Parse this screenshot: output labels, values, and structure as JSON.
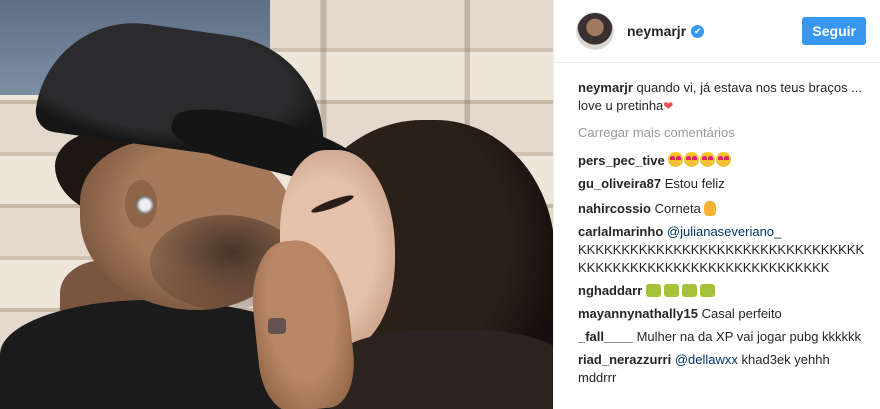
{
  "post": {
    "username": "neymarjr",
    "follow_label": "Seguir",
    "verified_glyph": "✔",
    "caption_text": "quando vi, já estava nos teus braços ... love u pretinha",
    "caption_heart": "❤",
    "load_more": "Carregar mais comentários"
  },
  "comments": [
    {
      "user": "pers_pec_tive",
      "text": "",
      "emoji": "heart-eyes-emoji x4"
    },
    {
      "user": "gu_oliveira87",
      "text": "Estou feliz"
    },
    {
      "user": "nahircossio",
      "text": "Corneta",
      "emoji": "victory-hand-emoji"
    },
    {
      "user": "carlalmarinho",
      "mention": "@julianaseveriano_",
      "text": "KKKKKKKKKKKKKKKKKKKKKKKKKKKKKKKKKKKKKKKKKKKKKKKKKKKKKKKKKKKKKK"
    },
    {
      "user": "nghaddarr",
      "text": "",
      "emoji": "gg-emoji x4"
    },
    {
      "user": "mayannynathally15",
      "text": "Casal perfeito"
    },
    {
      "user": "_fall____",
      "text": "Mulher na da XP vai jogar pubg kkkkkk"
    },
    {
      "user": "riad_nerazzurri",
      "mention": "@dellawxx",
      "text": "khad3ek yehhh mddrrr"
    }
  ],
  "colors": {
    "accent": "#3897f0",
    "text": "#262626",
    "muted": "#999999",
    "mention": "#003569",
    "heart": "#ed4956"
  }
}
